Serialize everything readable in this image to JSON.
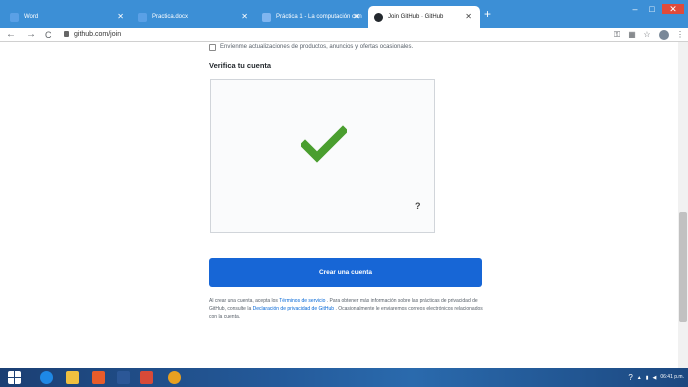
{
  "browser": {
    "tabs": [
      {
        "label": "Word",
        "color": "#2b5797"
      },
      {
        "label": "Practica.docx",
        "color": "#2b5797"
      },
      {
        "label": "Práctica 1 - La computación con",
        "color": "#2f6fd0"
      },
      {
        "label": "Join GitHub · GitHub",
        "color": "#24292e"
      }
    ],
    "new_tab": "+",
    "url": "github.com/join",
    "controls": {
      "back": "←",
      "forward": "→",
      "reload": "C",
      "star": "☆",
      "menu": "⋮",
      "minimize": "–",
      "maximize": "□",
      "close": "✕"
    }
  },
  "page": {
    "marketing_checkbox_label": "Envíenme actualizaciones de productos, anuncios y ofertas ocasionales.",
    "verify_title": "Verifica tu cuenta",
    "captcha_help": "?",
    "create_button": "Crear una cuenta",
    "legal": {
      "p1": "Al crear una cuenta, acepta los ",
      "terms_link": "Términos de servicio",
      "p2": " . Para obtener más información sobre las prácticas de privacidad de GitHub, consulte la ",
      "privacy_link": "Declaración de privacidad de GitHub",
      "p3": " . Ocasionalmente le enviaremos correos electrónicos relacionados con la cuenta."
    },
    "colors": {
      "accent": "#1766d6",
      "check": "#4a9e2f",
      "link": "#0366d6"
    }
  },
  "taskbar": {
    "clock_time": "06:41 p.m.",
    "icons": [
      "start-icon",
      "edge-icon",
      "file-explorer-icon",
      "office-icon",
      "word-icon",
      "photos-icon",
      "chrome-icon"
    ]
  }
}
